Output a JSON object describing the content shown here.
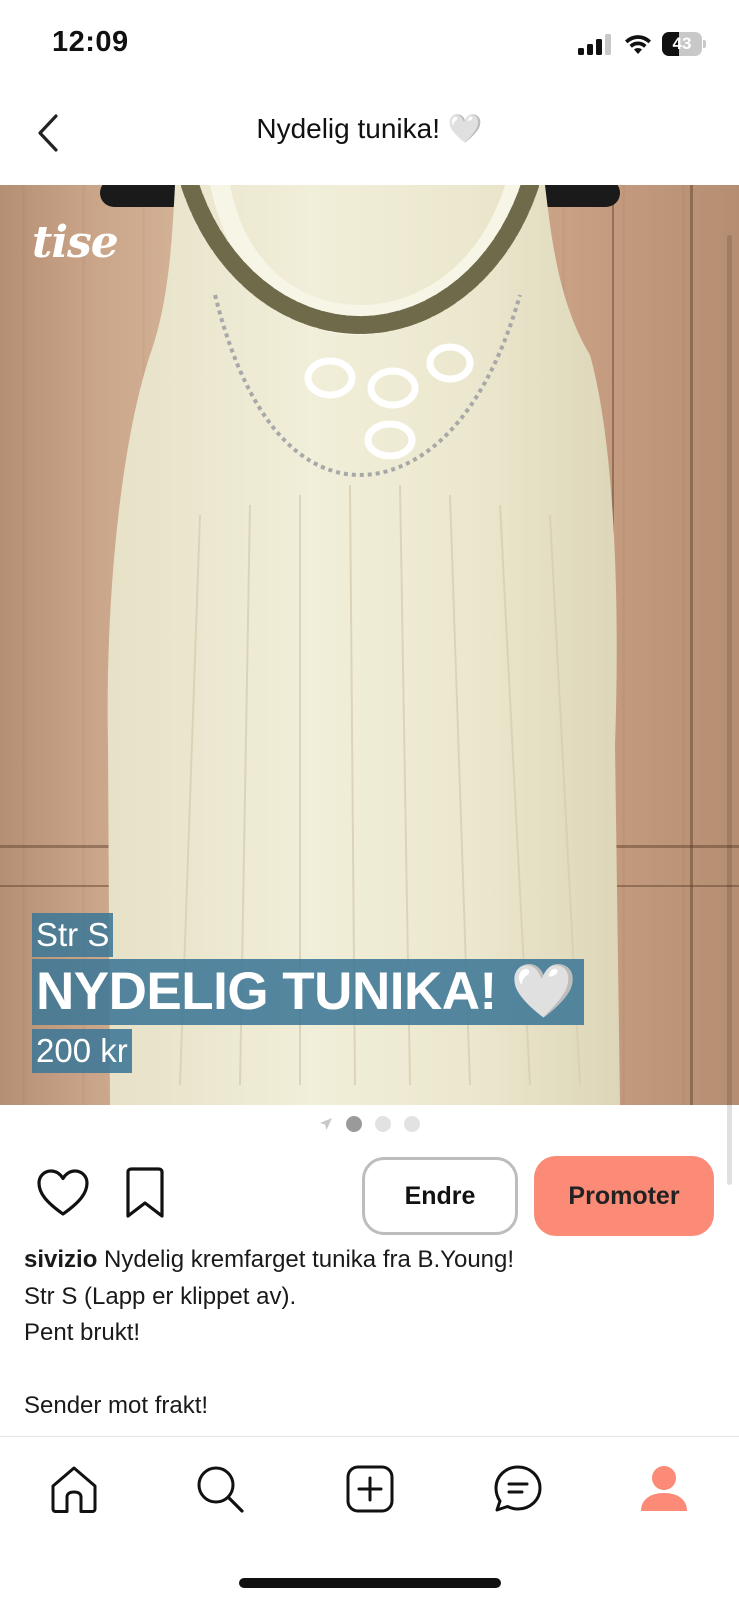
{
  "status_bar": {
    "time": "12:09",
    "battery": "43",
    "battery_level_percent": 43
  },
  "header": {
    "title": "Nydelig tunika! 🤍",
    "back_icon": "chevron-left-icon"
  },
  "photo": {
    "logo": "tise",
    "overlay": {
      "size": "Str S",
      "title": "NYDELIG TUNIKA! 🤍",
      "price": "200 kr"
    },
    "pager": {
      "total": 3,
      "active_index": 0,
      "leading_icon": "location-arrow-icon"
    }
  },
  "actions": {
    "like_icon": "heart-icon",
    "save_icon": "bookmark-icon",
    "edit_label": "Endre",
    "promote_label": "Promoter",
    "promote_color": "#fb8a76"
  },
  "description": {
    "username": "sivizio",
    "first_line": " Nydelig kremfarget tunika fra B.Young!",
    "lines": [
      "Str S (Lapp er klippet av).",
      "Pent brukt!",
      "",
      "Sender mot frakt!"
    ]
  },
  "bottom_nav": {
    "items": [
      "home-icon",
      "search-icon",
      "add-icon",
      "messages-icon",
      "profile-icon"
    ],
    "active_color": "#fb8a76"
  }
}
